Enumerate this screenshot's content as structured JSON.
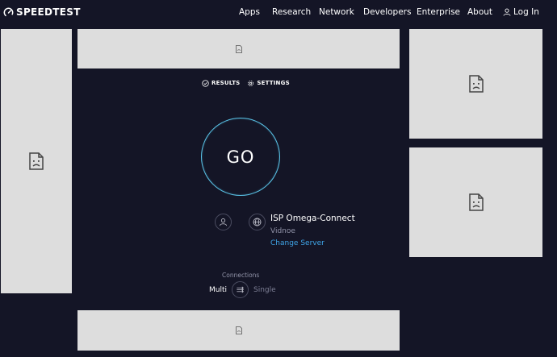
{
  "header": {
    "logo_text": "SPEEDTEST",
    "nav": [
      "Apps",
      "Research",
      "Network",
      "Developers",
      "Enterprise",
      "About"
    ],
    "login_label": "Log In"
  },
  "tabs": {
    "results": "RESULTS",
    "settings": "SETTINGS"
  },
  "go_button": "GO",
  "isp": {
    "name": "ISP Omega-Connect",
    "location": "Vidnoe",
    "change_server": "Change Server"
  },
  "connections": {
    "label": "Connections",
    "multi": "Multi",
    "single": "Single"
  },
  "colors": {
    "background": "#141526",
    "accent_ring": "#5ac4e8",
    "link": "#3fa5e8",
    "ad_placeholder": "#dddddd"
  }
}
